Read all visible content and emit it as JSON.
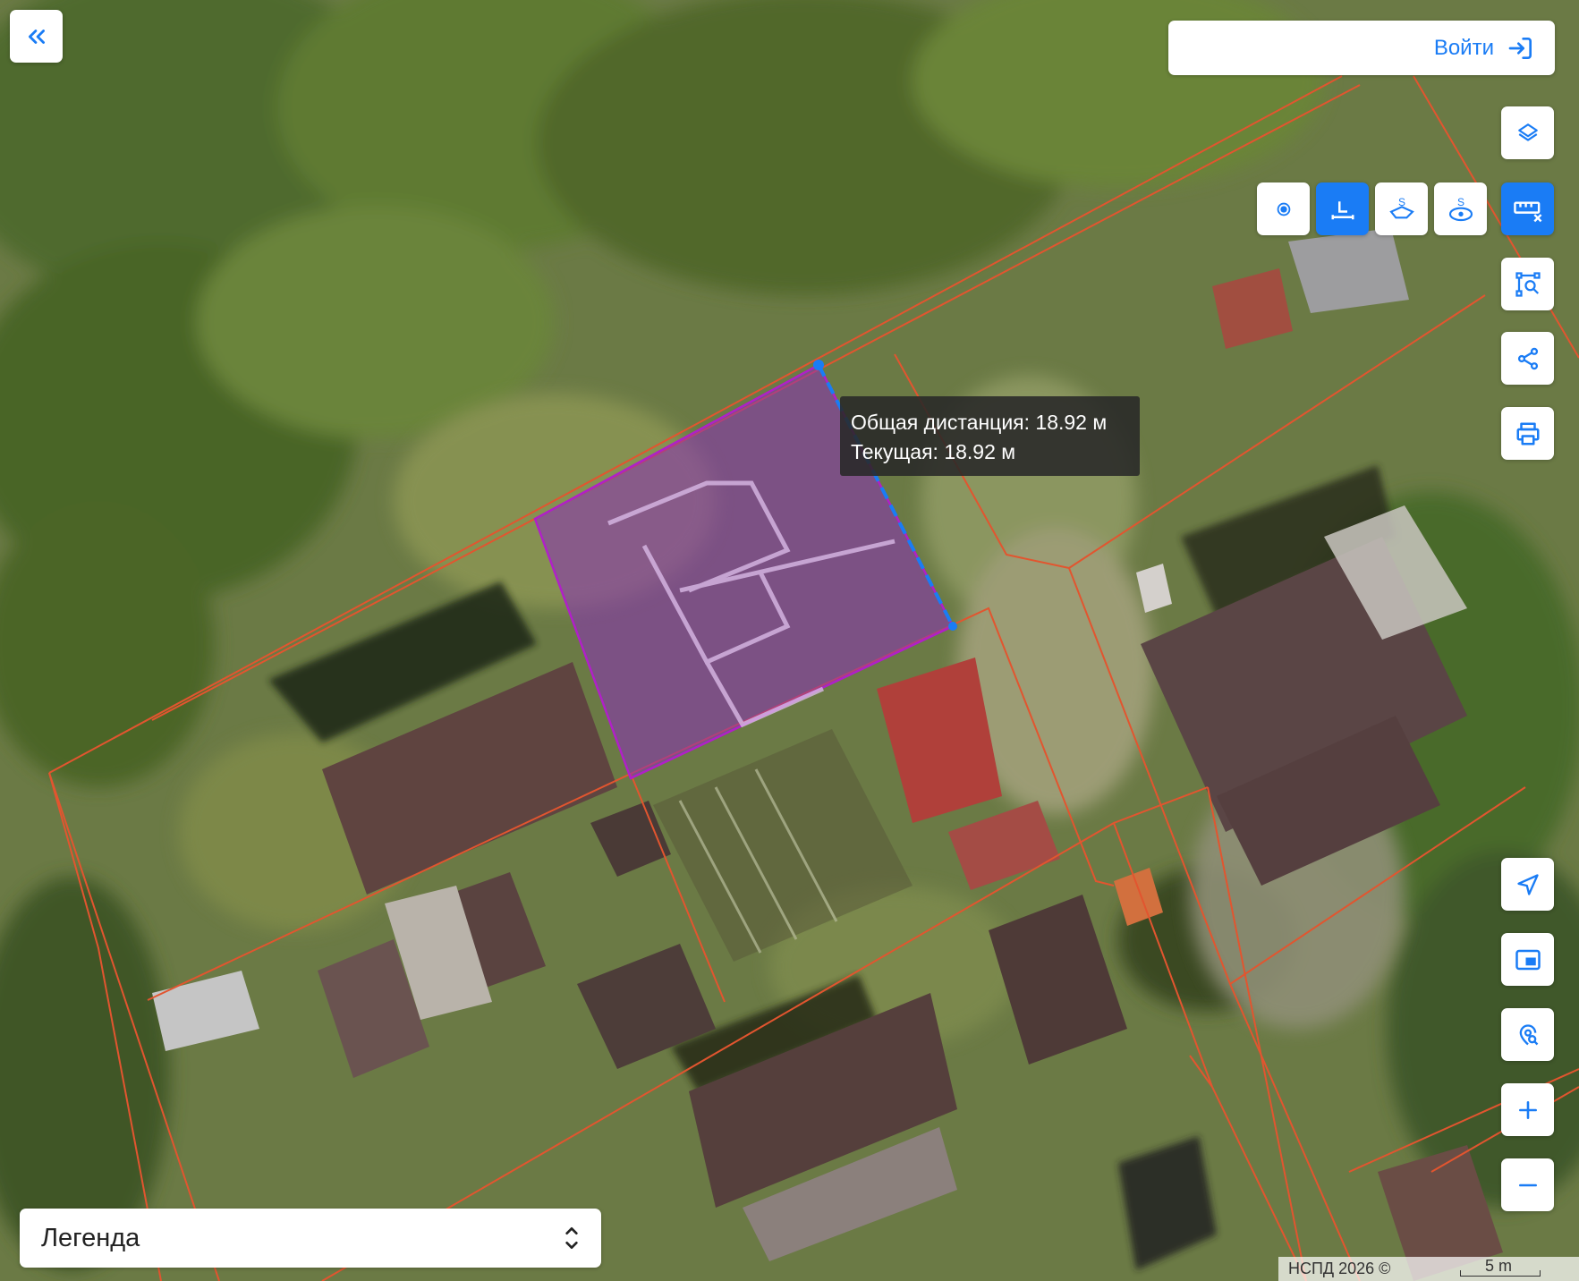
{
  "header": {
    "back_icon": "chevrons-left-icon",
    "login_label": "Войти",
    "login_icon": "login-icon"
  },
  "measure_toolbar": {
    "items": [
      {
        "name": "point-icon",
        "active": false
      },
      {
        "name": "line-measure-icon",
        "active": true
      },
      {
        "name": "polygon-area-icon",
        "active": false
      },
      {
        "name": "circle-area-icon",
        "active": false
      }
    ],
    "close_icon": "ruler-close-icon"
  },
  "right_controls": [
    "layers-icon",
    "ruler-close-icon",
    "select-area-icon",
    "share-icon",
    "print-icon"
  ],
  "bottom_controls": [
    "navigate-icon",
    "minimap-icon",
    "locate-search-icon",
    "zoom-in-icon",
    "zoom-out-icon"
  ],
  "tooltip": {
    "total": "Общая дистанция: 18.92 м",
    "current": "Текущая: 18.92 м"
  },
  "legend": {
    "label": "Легенда",
    "icon": "chevron-up-down-icon"
  },
  "attribution": "НСПД 2026 ©",
  "scale_label": "5 m",
  "colors": {
    "accent": "#1a7cf5",
    "parcel_border": "#e2552f",
    "selection": "#b020c8",
    "measure_line": "#1a7cf5"
  }
}
